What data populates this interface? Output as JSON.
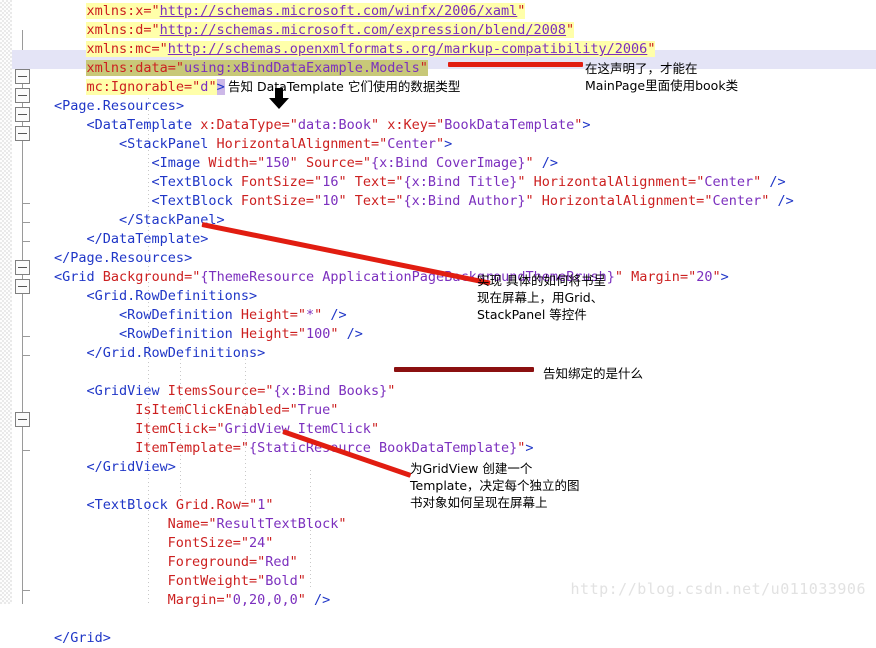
{
  "editor": {
    "language": "XAML",
    "lines": [
      {
        "indent": 4,
        "text": "xmlns:x=\"http://schemas.microsoft.com/winfx/2006/xaml\"",
        "highlight": "yellow"
      },
      {
        "indent": 4,
        "text": "xmlns:d=\"http://schemas.microsoft.com/expression/blend/2008\"",
        "highlight": "yellow"
      },
      {
        "indent": 4,
        "text": "xmlns:mc=\"http://schemas.openxmlformats.org/markup-compatibility/2006\"",
        "highlight": "yellow"
      },
      {
        "indent": 4,
        "text": "xmlns:data=\"using:xBindDataExample.Models\"",
        "highlight": "olive"
      },
      {
        "indent": 4,
        "text": "mc:Ignorable=\"d\">",
        "highlight": "yellow"
      },
      {
        "indent": 0,
        "text": "<Page.Resources>",
        "highlight": "none"
      },
      {
        "indent": 4,
        "text": "<DataTemplate x:DataType=\"data:Book\" x:Key=\"BookDataTemplate\">",
        "highlight": "none"
      },
      {
        "indent": 8,
        "text": "<StackPanel HorizontalAlignment=\"Center\">",
        "highlight": "none"
      },
      {
        "indent": 12,
        "text": "<Image Width=\"150\" Source=\"{x:Bind CoverImage}\" />",
        "highlight": "none"
      },
      {
        "indent": 12,
        "text": "<TextBlock FontSize=\"16\" Text=\"{x:Bind Title}\" HorizontalAlignment=\"Center\" />",
        "highlight": "none"
      },
      {
        "indent": 12,
        "text": "<TextBlock FontSize=\"10\" Text=\"{x:Bind Author}\" HorizontalAlignment=\"Center\" />",
        "highlight": "none"
      },
      {
        "indent": 8,
        "text": "</StackPanel>",
        "highlight": "none"
      },
      {
        "indent": 4,
        "text": "</DataTemplate>",
        "highlight": "none"
      },
      {
        "indent": 0,
        "text": "</Page.Resources>",
        "highlight": "none"
      },
      {
        "indent": 0,
        "text": "<Grid Background=\"{ThemeResource ApplicationPageBackgroundThemeBrush}\" Margin=\"20\">",
        "highlight": "none"
      },
      {
        "indent": 4,
        "text": "<Grid.RowDefinitions>",
        "highlight": "none"
      },
      {
        "indent": 8,
        "text": "<RowDefinition Height=\"*\" />",
        "highlight": "none"
      },
      {
        "indent": 8,
        "text": "<RowDefinition Height=\"100\" />",
        "highlight": "none"
      },
      {
        "indent": 4,
        "text": "</Grid.RowDefinitions>",
        "highlight": "none"
      },
      {
        "indent": 0,
        "text": "",
        "highlight": "none"
      },
      {
        "indent": 4,
        "text": "<GridView ItemsSource=\"{x:Bind Books}\"",
        "highlight": "none"
      },
      {
        "indent": 10,
        "text": "IsItemClickEnabled=\"True\"",
        "highlight": "none"
      },
      {
        "indent": 10,
        "text": "ItemClick=\"GridView_ItemClick\"",
        "highlight": "none"
      },
      {
        "indent": 10,
        "text": "ItemTemplate=\"{StaticResource BookDataTemplate}\">",
        "highlight": "none"
      },
      {
        "indent": 4,
        "text": "</GridView>",
        "highlight": "none"
      },
      {
        "indent": 0,
        "text": "",
        "highlight": "none"
      },
      {
        "indent": 4,
        "text": "<TextBlock Grid.Row=\"1\"",
        "highlight": "none"
      },
      {
        "indent": 14,
        "text": "Name=\"ResultTextBlock\"",
        "highlight": "none"
      },
      {
        "indent": 14,
        "text": "FontSize=\"24\"",
        "highlight": "none"
      },
      {
        "indent": 14,
        "text": "Foreground=\"Red\"",
        "highlight": "none"
      },
      {
        "indent": 14,
        "text": "FontWeight=\"Bold\"",
        "highlight": "none"
      },
      {
        "indent": 14,
        "text": "Margin=\"0,20,0,0\" />",
        "highlight": "none"
      },
      {
        "indent": 0,
        "text": "",
        "highlight": "none"
      },
      {
        "indent": 0,
        "text": "</Grid>",
        "highlight": "none"
      }
    ]
  },
  "annotations": {
    "datatype_note": "告知 DataTemplate 它们使用的数据类型",
    "namespace_note": "在这声明了，才能在\nMainPage里面使用book类",
    "grid_note": "实现 具体的如何将书呈\n现在屏幕上，用Grid、\nStackPanel 等控件",
    "binding_note": "告知绑定的是什么",
    "template_note": "为GridView 创建一个\nTemplate，决定每个独立的图\n书对象如何呈现在屏幕上"
  },
  "watermark": "http://blog.csdn.net/u011033906",
  "colors": {
    "tag": "#1f36c7",
    "attribute": "#cc2020",
    "value": "#7b2fbe",
    "highlight_yellow": "#ffffaa",
    "highlight_olive": "#c8c878",
    "selection_band": "#e4e4f6",
    "arrow_red": "#e11d11",
    "arrow_dark_red": "#8b1010",
    "watermark": "#e2e2e2"
  }
}
